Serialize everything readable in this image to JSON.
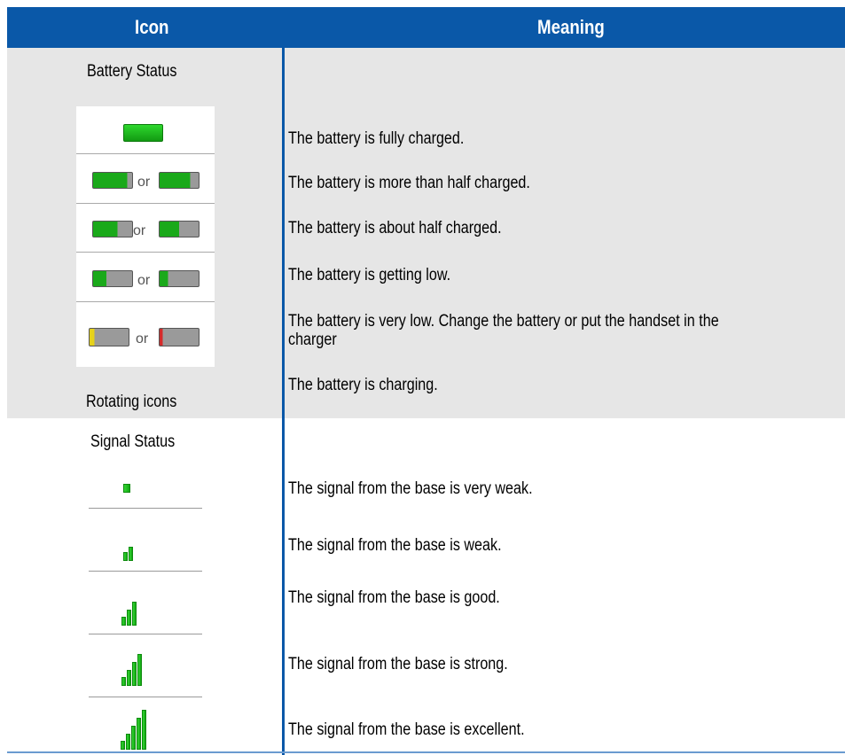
{
  "header": {
    "icon_col": "Icon",
    "meaning_col": "Meaning"
  },
  "battery": {
    "section_title": "Battery Status",
    "rows": [
      {
        "meaning": "The battery is fully charged.",
        "separator": ""
      },
      {
        "meaning": "The battery is more than half charged.",
        "separator": "or"
      },
      {
        "meaning": "The battery is about half charged.",
        "separator": "or"
      },
      {
        "meaning": "The battery is getting low.",
        "separator": "or"
      },
      {
        "meaning_line1": "The battery is very low. Change the battery or put the handset in the",
        "meaning_line2": "charger",
        "separator": "or"
      }
    ],
    "charging_label": "Rotating icons",
    "charging_meaning": "The battery is charging."
  },
  "signal": {
    "section_title": "Signal Status",
    "rows": [
      {
        "meaning": "The signal from the base is very weak.",
        "bars": 1
      },
      {
        "meaning": "The signal from the base is weak.",
        "bars": 2
      },
      {
        "meaning": "The signal from the base is good.",
        "bars": 3
      },
      {
        "meaning": "The signal from the base is strong.",
        "bars": 4
      },
      {
        "meaning": "The signal from the base is excellent.",
        "bars": 5
      }
    ]
  },
  "colors": {
    "header_blue": "#0a58a8",
    "battery_green": "#19b019",
    "low_yellow": "#e6d21a",
    "low_red": "#d42a2a",
    "section_gray": "#e6e6e6"
  }
}
